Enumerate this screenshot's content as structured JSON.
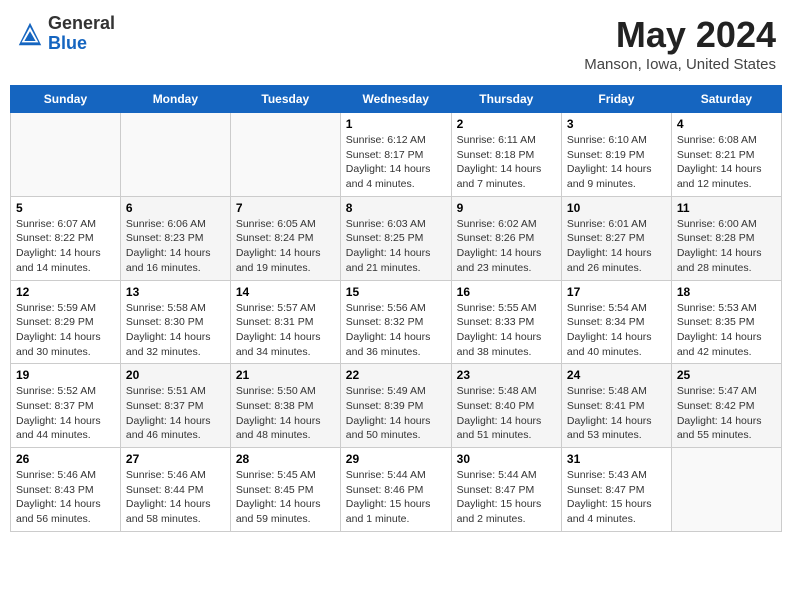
{
  "header": {
    "logo_general": "General",
    "logo_blue": "Blue",
    "month": "May 2024",
    "location": "Manson, Iowa, United States"
  },
  "weekdays": [
    "Sunday",
    "Monday",
    "Tuesday",
    "Wednesday",
    "Thursday",
    "Friday",
    "Saturday"
  ],
  "weeks": [
    [
      {
        "day": "",
        "sunrise": "",
        "sunset": "",
        "daylight": ""
      },
      {
        "day": "",
        "sunrise": "",
        "sunset": "",
        "daylight": ""
      },
      {
        "day": "",
        "sunrise": "",
        "sunset": "",
        "daylight": ""
      },
      {
        "day": "1",
        "sunrise": "Sunrise: 6:12 AM",
        "sunset": "Sunset: 8:17 PM",
        "daylight": "Daylight: 14 hours and 4 minutes."
      },
      {
        "day": "2",
        "sunrise": "Sunrise: 6:11 AM",
        "sunset": "Sunset: 8:18 PM",
        "daylight": "Daylight: 14 hours and 7 minutes."
      },
      {
        "day": "3",
        "sunrise": "Sunrise: 6:10 AM",
        "sunset": "Sunset: 8:19 PM",
        "daylight": "Daylight: 14 hours and 9 minutes."
      },
      {
        "day": "4",
        "sunrise": "Sunrise: 6:08 AM",
        "sunset": "Sunset: 8:21 PM",
        "daylight": "Daylight: 14 hours and 12 minutes."
      }
    ],
    [
      {
        "day": "5",
        "sunrise": "Sunrise: 6:07 AM",
        "sunset": "Sunset: 8:22 PM",
        "daylight": "Daylight: 14 hours and 14 minutes."
      },
      {
        "day": "6",
        "sunrise": "Sunrise: 6:06 AM",
        "sunset": "Sunset: 8:23 PM",
        "daylight": "Daylight: 14 hours and 16 minutes."
      },
      {
        "day": "7",
        "sunrise": "Sunrise: 6:05 AM",
        "sunset": "Sunset: 8:24 PM",
        "daylight": "Daylight: 14 hours and 19 minutes."
      },
      {
        "day": "8",
        "sunrise": "Sunrise: 6:03 AM",
        "sunset": "Sunset: 8:25 PM",
        "daylight": "Daylight: 14 hours and 21 minutes."
      },
      {
        "day": "9",
        "sunrise": "Sunrise: 6:02 AM",
        "sunset": "Sunset: 8:26 PM",
        "daylight": "Daylight: 14 hours and 23 minutes."
      },
      {
        "day": "10",
        "sunrise": "Sunrise: 6:01 AM",
        "sunset": "Sunset: 8:27 PM",
        "daylight": "Daylight: 14 hours and 26 minutes."
      },
      {
        "day": "11",
        "sunrise": "Sunrise: 6:00 AM",
        "sunset": "Sunset: 8:28 PM",
        "daylight": "Daylight: 14 hours and 28 minutes."
      }
    ],
    [
      {
        "day": "12",
        "sunrise": "Sunrise: 5:59 AM",
        "sunset": "Sunset: 8:29 PM",
        "daylight": "Daylight: 14 hours and 30 minutes."
      },
      {
        "day": "13",
        "sunrise": "Sunrise: 5:58 AM",
        "sunset": "Sunset: 8:30 PM",
        "daylight": "Daylight: 14 hours and 32 minutes."
      },
      {
        "day": "14",
        "sunrise": "Sunrise: 5:57 AM",
        "sunset": "Sunset: 8:31 PM",
        "daylight": "Daylight: 14 hours and 34 minutes."
      },
      {
        "day": "15",
        "sunrise": "Sunrise: 5:56 AM",
        "sunset": "Sunset: 8:32 PM",
        "daylight": "Daylight: 14 hours and 36 minutes."
      },
      {
        "day": "16",
        "sunrise": "Sunrise: 5:55 AM",
        "sunset": "Sunset: 8:33 PM",
        "daylight": "Daylight: 14 hours and 38 minutes."
      },
      {
        "day": "17",
        "sunrise": "Sunrise: 5:54 AM",
        "sunset": "Sunset: 8:34 PM",
        "daylight": "Daylight: 14 hours and 40 minutes."
      },
      {
        "day": "18",
        "sunrise": "Sunrise: 5:53 AM",
        "sunset": "Sunset: 8:35 PM",
        "daylight": "Daylight: 14 hours and 42 minutes."
      }
    ],
    [
      {
        "day": "19",
        "sunrise": "Sunrise: 5:52 AM",
        "sunset": "Sunset: 8:37 PM",
        "daylight": "Daylight: 14 hours and 44 minutes."
      },
      {
        "day": "20",
        "sunrise": "Sunrise: 5:51 AM",
        "sunset": "Sunset: 8:37 PM",
        "daylight": "Daylight: 14 hours and 46 minutes."
      },
      {
        "day": "21",
        "sunrise": "Sunrise: 5:50 AM",
        "sunset": "Sunset: 8:38 PM",
        "daylight": "Daylight: 14 hours and 48 minutes."
      },
      {
        "day": "22",
        "sunrise": "Sunrise: 5:49 AM",
        "sunset": "Sunset: 8:39 PM",
        "daylight": "Daylight: 14 hours and 50 minutes."
      },
      {
        "day": "23",
        "sunrise": "Sunrise: 5:48 AM",
        "sunset": "Sunset: 8:40 PM",
        "daylight": "Daylight: 14 hours and 51 minutes."
      },
      {
        "day": "24",
        "sunrise": "Sunrise: 5:48 AM",
        "sunset": "Sunset: 8:41 PM",
        "daylight": "Daylight: 14 hours and 53 minutes."
      },
      {
        "day": "25",
        "sunrise": "Sunrise: 5:47 AM",
        "sunset": "Sunset: 8:42 PM",
        "daylight": "Daylight: 14 hours and 55 minutes."
      }
    ],
    [
      {
        "day": "26",
        "sunrise": "Sunrise: 5:46 AM",
        "sunset": "Sunset: 8:43 PM",
        "daylight": "Daylight: 14 hours and 56 minutes."
      },
      {
        "day": "27",
        "sunrise": "Sunrise: 5:46 AM",
        "sunset": "Sunset: 8:44 PM",
        "daylight": "Daylight: 14 hours and 58 minutes."
      },
      {
        "day": "28",
        "sunrise": "Sunrise: 5:45 AM",
        "sunset": "Sunset: 8:45 PM",
        "daylight": "Daylight: 14 hours and 59 minutes."
      },
      {
        "day": "29",
        "sunrise": "Sunrise: 5:44 AM",
        "sunset": "Sunset: 8:46 PM",
        "daylight": "Daylight: 15 hours and 1 minute."
      },
      {
        "day": "30",
        "sunrise": "Sunrise: 5:44 AM",
        "sunset": "Sunset: 8:47 PM",
        "daylight": "Daylight: 15 hours and 2 minutes."
      },
      {
        "day": "31",
        "sunrise": "Sunrise: 5:43 AM",
        "sunset": "Sunset: 8:47 PM",
        "daylight": "Daylight: 15 hours and 4 minutes."
      },
      {
        "day": "",
        "sunrise": "",
        "sunset": "",
        "daylight": ""
      }
    ]
  ]
}
